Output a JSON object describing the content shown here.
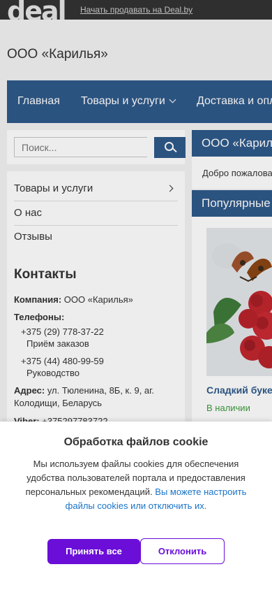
{
  "header": {
    "logo": "deal",
    "sell_link": "Начать продавать на Deal.by",
    "company_name": "ООО «Карилья»"
  },
  "nav": {
    "items": [
      "Главная",
      "Товары и услуги",
      "Доставка и оплата"
    ]
  },
  "search": {
    "placeholder": "Поиск..."
  },
  "sidebar": {
    "menu": [
      "Товары и услуги",
      "О нас",
      "Отзывы"
    ],
    "contacts_title": "Контакты",
    "company_label": "Компания:",
    "company_value": "ООО «Карилья»",
    "phones_label": "Телефоны:",
    "phones": [
      {
        "number": "+375 (29) 778-37-22",
        "note": "Приём заказов"
      },
      {
        "number": "+375 (44) 480-99-59",
        "note": "Руководство"
      }
    ],
    "address_label": "Адрес:",
    "address_value": "ул. Тюленина, 8Б, к. 9, аг. Колодищи, Беларусь",
    "viber_label": "Viber:",
    "viber_value": "+375297783722"
  },
  "main": {
    "company_heading": "ООО «Карилья»",
    "welcome": "Добро пожаловать",
    "popular_heading": "Популярные товары",
    "product": {
      "title": "Сладкий букет",
      "stock": "В наличии"
    }
  },
  "cookie": {
    "title": "Обработка файлов cookie",
    "text": "Мы используем файлы cookies для обеспечения удобства пользователей портала и предоставления персональных рекомендаций.",
    "link": "Вы можете настроить файлы cookies или отключить их.",
    "accept_label": "Принять все",
    "decline_label": "Отклонить",
    "accent_color": "#6a0ed8"
  }
}
